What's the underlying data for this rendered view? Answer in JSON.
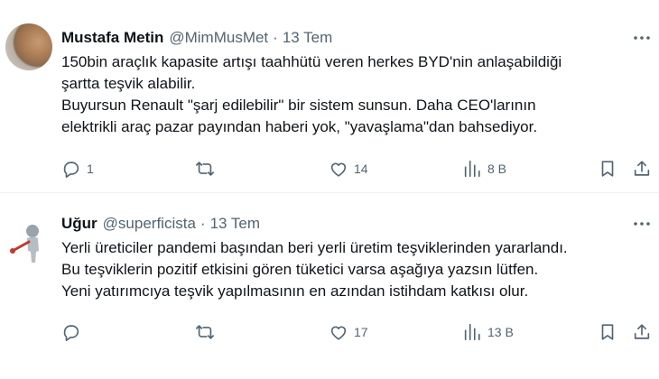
{
  "tweets": [
    {
      "name": "Mustafa Metin",
      "handle": "@MimMusMet",
      "separator": "·",
      "time": "13 Tem",
      "lines": [
        "150bin araçlık kapasite artışı taahhütü veren herkes BYD'nin anlaşabildiği",
        "şartta teşvik alabilir.",
        "Buyursun Renault  \"şarj edilebilir\" bir sistem sunsun. Daha CEO'larının",
        "elektrikli araç pazar payından haberi yok, \"yavaşlama\"dan bahsediyor."
      ],
      "replies": "1",
      "retweets": "",
      "likes": "14",
      "views": "8 B"
    },
    {
      "name": "Uğur",
      "handle": "@superficista",
      "separator": "·",
      "time": "13 Tem",
      "lines": [
        "Yerli üreticiler pandemi başından beri yerli üretim teşviklerinden yararlandı.",
        "Bu teşviklerin pozitif etkisini gören tüketici varsa aşağıya yazsın lütfen.",
        "Yeni yatırımcıya teşvik yapılmasının en azından istihdam katkısı olur."
      ],
      "replies": "",
      "retweets": "",
      "likes": "17",
      "views": "13 B"
    }
  ],
  "icons": {
    "more": "more-horizontal-icon",
    "reply": "reply-icon",
    "retweet": "retweet-icon",
    "like": "heart-icon",
    "views": "analytics-icon",
    "bookmark": "bookmark-icon",
    "share": "share-icon"
  },
  "colors": {
    "text": "#0f1419",
    "secondary": "#536471",
    "divider": "#eff3f4"
  }
}
